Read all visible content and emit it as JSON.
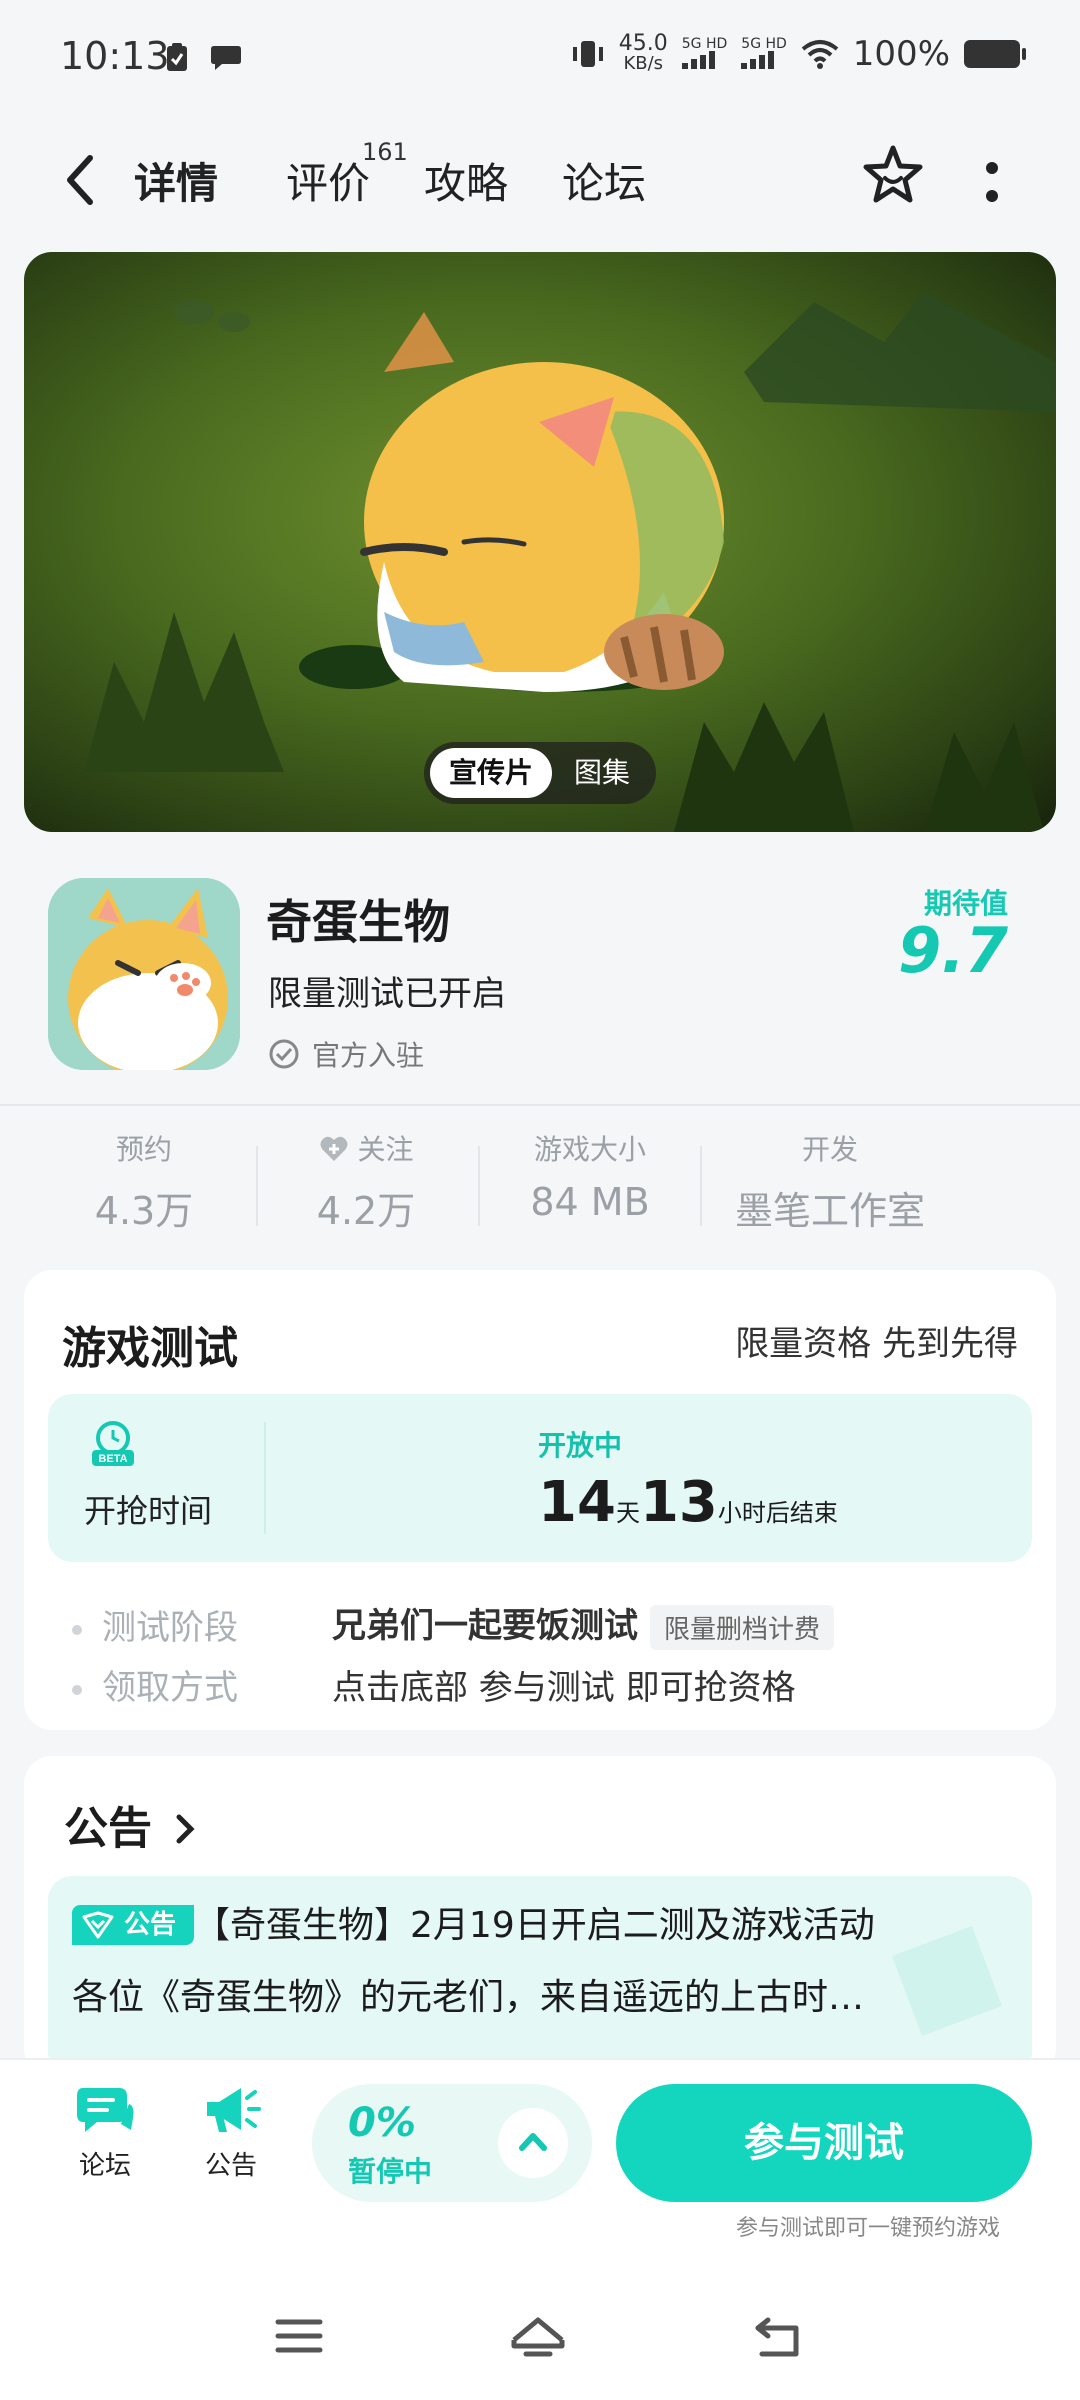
{
  "status_bar": {
    "time": "10:13",
    "speed_value": "45.0",
    "speed_unit": "KB/s",
    "net1": "5G HD",
    "net2": "5G HD",
    "battery": "100%"
  },
  "nav": {
    "tabs": [
      "详情",
      "评价",
      "攻略",
      "论坛"
    ],
    "review_count": "161"
  },
  "hero": {
    "toggle_video": "宣传片",
    "toggle_gallery": "图集"
  },
  "app": {
    "name": "奇蛋生物",
    "subtitle": "限量测试已开启",
    "official": "官方入驻",
    "expect_label": "期待值",
    "expect_value": "9.7"
  },
  "stats": [
    {
      "label": "预约",
      "value": "4.3万"
    },
    {
      "label": "关注",
      "value": "4.2万"
    },
    {
      "label": "游戏大小",
      "value": "84 MB"
    },
    {
      "label": "开发",
      "value": "墨笔工作室"
    }
  ],
  "test": {
    "title": "游戏测试",
    "right": "限量资格 先到先得",
    "timer_label": "开抢时间",
    "status": "开放中",
    "days": "14",
    "days_unit": "天",
    "hours": "13",
    "hours_unit": "小时后结束",
    "stage_label": "测试阶段",
    "stage_value": "兄弟们一起要饭测试",
    "stage_tag": "限量删档计费",
    "claim_label": "领取方式",
    "claim_value": "点击底部 参与测试 即可抢资格"
  },
  "notice": {
    "title": "公告",
    "badge": "公告",
    "line1": "【奇蛋生物】2月19日开启二测及游戏活动",
    "line2": "各位《奇蛋生物》的元老们，来自遥远的上古时…"
  },
  "bottom": {
    "forum": "论坛",
    "notice": "公告",
    "progress": "0%",
    "progress_status": "暂停中",
    "cta": "参与测试",
    "cta_note": "参与测试即可一键预约游戏"
  },
  "colors": {
    "accent": "#16d5bf",
    "accent_dark": "#14c8b2",
    "bg": "#f4f6f8"
  }
}
